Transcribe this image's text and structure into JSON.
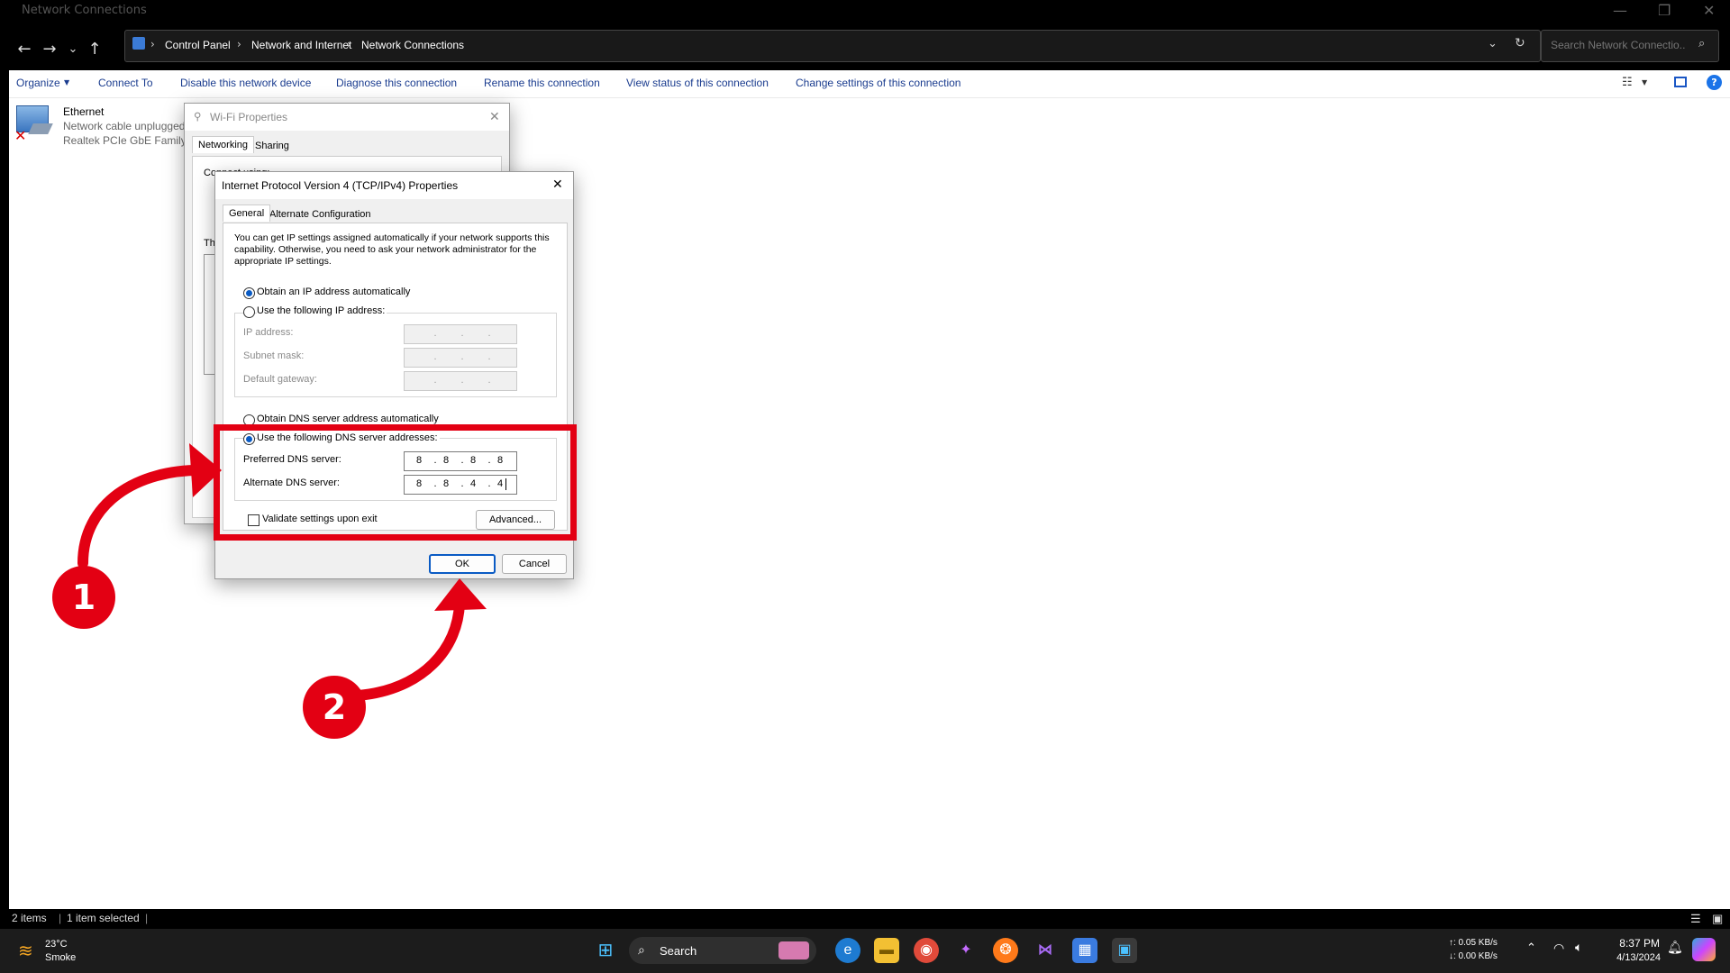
{
  "window": {
    "title": "Network Connections",
    "breadcrumb": [
      "Control Panel",
      "Network and Internet",
      "Network Connections"
    ],
    "search_placeholder": "Search Network Connectio..."
  },
  "commands": [
    "Organize",
    "Connect To",
    "Disable this network device",
    "Diagnose this connection",
    "Rename this connection",
    "View status of this connection",
    "Change settings of this connection"
  ],
  "adapter": {
    "name": "Ethernet",
    "status": "Network cable unplugged",
    "device": "Realtek PCIe GbE Family C"
  },
  "wifi_dialog": {
    "title": "Wi-Fi Properties",
    "tabs": [
      "Networking",
      "Sharing"
    ],
    "connect_using_partial": "Connect using:",
    "th_partial": "Th"
  },
  "ipv4_dialog": {
    "title": "Internet Protocol Version 4 (TCP/IPv4) Properties",
    "tabs": [
      "General",
      "Alternate Configuration"
    ],
    "intro": "You can get IP settings assigned automatically if your network supports this capability. Otherwise, you need to ask your network administrator for the appropriate IP settings.",
    "obtain_ip_auto": "Obtain an IP address automatically",
    "use_following_ip": "Use the following IP address:",
    "ip_address_label": "IP address:",
    "subnet_label": "Subnet mask:",
    "gateway_label": "Default gateway:",
    "obtain_dns_auto": "Obtain DNS server address automatically",
    "use_following_dns": "Use the following DNS server addresses:",
    "preferred_dns_label": "Preferred DNS server:",
    "alternate_dns_label": "Alternate DNS server:",
    "preferred_dns": [
      "8",
      "8",
      "8",
      "8"
    ],
    "alternate_dns": [
      "8",
      "8",
      "4",
      "4"
    ],
    "validate_label": "Validate settings upon exit",
    "advanced_button": "Advanced...",
    "ok_button": "OK",
    "cancel_button": "Cancel"
  },
  "status_bar": {
    "items_count": "2 items",
    "selected": "1 item selected"
  },
  "annotations": {
    "badge1": "1",
    "badge2": "2",
    "accent": "#e30013"
  },
  "taskbar": {
    "weather_temp": "23°C",
    "weather_desc": "Smoke",
    "search_label": "Search",
    "net_up": "↑: 0.05 KB/s",
    "net_down": "↓: 0.00 KB/s",
    "time": "8:37 PM",
    "date": "4/13/2024"
  }
}
